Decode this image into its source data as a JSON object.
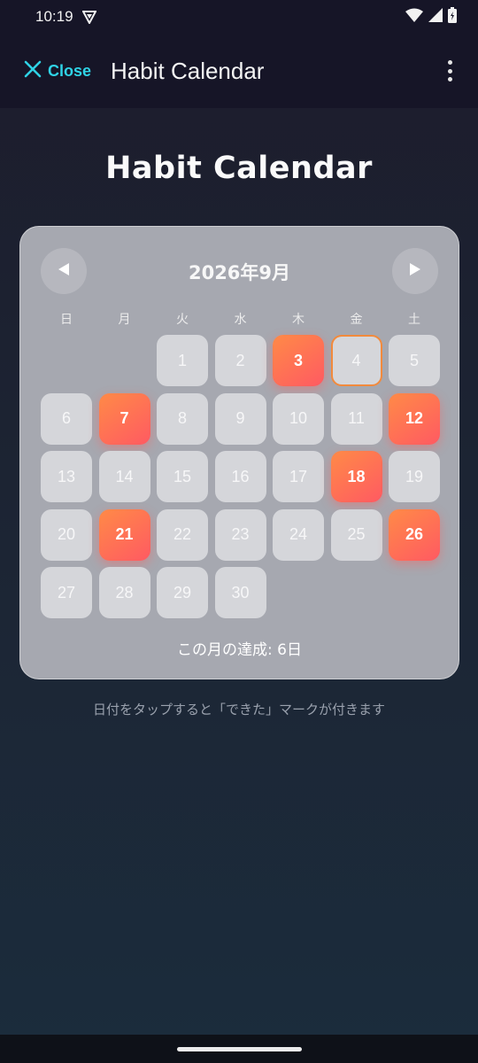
{
  "status_bar": {
    "time": "10:19"
  },
  "app_bar": {
    "close_label": "Close",
    "title": "Habit Calendar"
  },
  "page": {
    "title": "Habit Calendar",
    "hint": "日付をタップすると「できた」マークが付きます"
  },
  "calendar": {
    "month_label": "2026年9月",
    "weekdays": [
      "日",
      "月",
      "火",
      "水",
      "木",
      "金",
      "土"
    ],
    "first_weekday_index": 2,
    "days": [
      {
        "label": "1",
        "done": false
      },
      {
        "label": "2",
        "done": false
      },
      {
        "label": "3",
        "done": true
      },
      {
        "label": "4",
        "done": false,
        "today": true
      },
      {
        "label": "5",
        "done": false
      },
      {
        "label": "6",
        "done": false
      },
      {
        "label": "7",
        "done": true
      },
      {
        "label": "8",
        "done": false
      },
      {
        "label": "9",
        "done": false
      },
      {
        "label": "10",
        "done": false
      },
      {
        "label": "11",
        "done": false
      },
      {
        "label": "12",
        "done": true
      },
      {
        "label": "13",
        "done": false
      },
      {
        "label": "14",
        "done": false
      },
      {
        "label": "15",
        "done": false
      },
      {
        "label": "16",
        "done": false
      },
      {
        "label": "17",
        "done": false
      },
      {
        "label": "18",
        "done": true
      },
      {
        "label": "19",
        "done": false
      },
      {
        "label": "20",
        "done": false
      },
      {
        "label": "21",
        "done": true
      },
      {
        "label": "22",
        "done": false
      },
      {
        "label": "23",
        "done": false
      },
      {
        "label": "24",
        "done": false
      },
      {
        "label": "25",
        "done": false
      },
      {
        "label": "26",
        "done": true
      },
      {
        "label": "27",
        "done": false
      },
      {
        "label": "28",
        "done": false
      },
      {
        "label": "29",
        "done": false
      },
      {
        "label": "30",
        "done": false
      }
    ],
    "summary": "この月の達成: 6日"
  },
  "colors": {
    "accent": "#2fd3e6",
    "done_gradient_start": "#ff8a47",
    "done_gradient_end": "#ff5a62",
    "today_border": "#f28a3c"
  },
  "icons": {
    "close": "close-icon",
    "more": "more-vert-icon",
    "prev": "triangle-left-icon",
    "next": "triangle-right-icon"
  }
}
